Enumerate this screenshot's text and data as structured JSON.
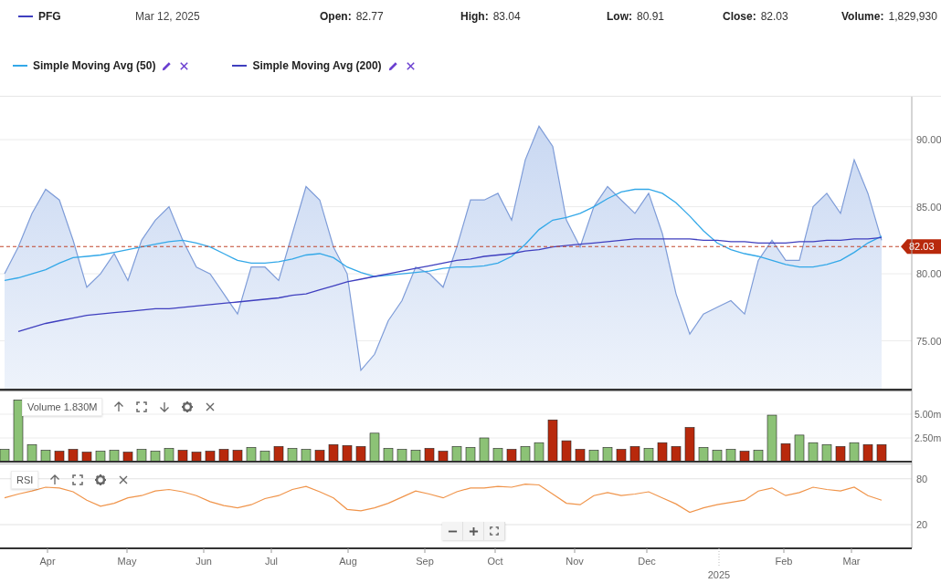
{
  "header": {
    "date": "Mar 12, 2025",
    "stats": [
      {
        "label": "Open:",
        "value": "82.77"
      },
      {
        "label": "High:",
        "value": "83.04"
      },
      {
        "label": "Low:",
        "value": "80.91"
      },
      {
        "label": "Close:",
        "value": "82.03"
      },
      {
        "label": "Volume:",
        "value": "1,829,930"
      }
    ]
  },
  "price_chart": {
    "chart_data": {
      "type": "area",
      "grid": true,
      "ref_lines": [
        {
          "axis": "y",
          "value": 82.03,
          "label": "82.03",
          "color": "#c0442a"
        }
      ],
      "ylim": [
        71.3,
        93.2
      ],
      "yticks": [
        {
          "value": 75,
          "label": "75.00"
        },
        {
          "value": 80,
          "label": "80.00"
        },
        {
          "value": 85,
          "label": "85.00"
        },
        {
          "value": 90,
          "label": "90.00"
        }
      ],
      "series": [
        {
          "name": "PFG",
          "color": "#7e9cd8",
          "values": [
            80.0,
            82,
            84.5,
            86.3,
            85.5,
            82.5,
            79,
            80,
            81.5,
            79.5,
            82.5,
            84,
            85,
            82.5,
            80.5,
            80,
            78.5,
            77,
            80.5,
            80.5,
            79.5,
            83,
            86.5,
            85.5,
            82,
            80,
            72.8,
            74,
            76.5,
            78,
            80.5,
            80,
            79,
            82,
            85.5,
            85.5,
            86,
            84,
            88.5,
            91,
            89.5,
            84,
            82,
            85,
            86.5,
            85.5,
            84.5,
            86,
            83,
            78.5,
            75.5,
            77,
            77.5,
            78,
            77,
            81,
            82.5,
            81,
            81,
            85,
            86,
            84.5,
            88.5,
            86,
            82.5
          ]
        },
        {
          "name": "Simple Moving Avg (50)",
          "type": "line",
          "color": "#33a8e8",
          "values": [
            79.5,
            79.7,
            80,
            80.3,
            80.8,
            81.2,
            81.3,
            81.4,
            81.6,
            81.8,
            82,
            82.2,
            82.4,
            82.5,
            82.3,
            82,
            81.5,
            81,
            80.8,
            80.8,
            80.9,
            81.1,
            81.4,
            81.5,
            81.2,
            80.5,
            80.1,
            79.8,
            79.9,
            80,
            80.1,
            80.2,
            80.4,
            80.5,
            80.5,
            80.6,
            80.8,
            81.3,
            82.2,
            83.3,
            84,
            84.2,
            84.5,
            85,
            85.6,
            86.1,
            86.3,
            86.3,
            86,
            85.3,
            84.3,
            83.2,
            82.3,
            81.8,
            81.5,
            81.3,
            81,
            80.7,
            80.5,
            80.5,
            80.7,
            81,
            81.6,
            82.3,
            82.8
          ]
        },
        {
          "name": "Simple Moving Avg (200)",
          "type": "line",
          "color": "#3f3fbf",
          "values": [
            null,
            75.7,
            76,
            76.3,
            76.5,
            76.7,
            76.9,
            77,
            77.1,
            77.2,
            77.3,
            77.4,
            77.4,
            77.5,
            77.6,
            77.7,
            77.8,
            77.9,
            78,
            78.1,
            78.2,
            78.4,
            78.5,
            78.8,
            79.1,
            79.4,
            79.6,
            79.8,
            80,
            80.2,
            80.4,
            80.6,
            80.8,
            81,
            81.1,
            81.3,
            81.4,
            81.5,
            81.7,
            81.8,
            82,
            82.1,
            82.2,
            82.3,
            82.4,
            82.5,
            82.6,
            82.6,
            82.6,
            82.6,
            82.6,
            82.5,
            82.5,
            82.4,
            82.4,
            82.3,
            82.3,
            82.3,
            82.4,
            82.4,
            82.5,
            82.5,
            82.6,
            82.6,
            82.7
          ]
        }
      ]
    }
  },
  "volume_panel": {
    "current_value": "1.830M",
    "chart_data": {
      "type": "bar",
      "grid": true,
      "ylim": [
        0,
        7.5
      ],
      "yticks": [
        {
          "value": 5,
          "label": "5.00m"
        },
        {
          "value": 2.5,
          "label": "2.50m"
        }
      ],
      "series": [
        {
          "name": "Volume",
          "color": "#8cc276",
          "values": [
            1.3,
            6.5,
            1.8,
            1.2,
            null,
            null,
            null,
            1.1,
            1.2,
            null,
            1.3,
            1.1,
            1.4,
            null,
            null,
            null,
            null,
            null,
            1.5,
            1.1,
            null,
            1.4,
            1.3,
            null,
            null,
            null,
            null,
            3.0,
            1.4,
            1.3,
            1.2,
            null,
            null,
            1.6,
            1.5,
            2.5,
            1.4,
            null,
            1.6,
            2.0,
            null,
            null,
            null,
            1.2,
            1.5,
            null,
            null,
            1.4,
            null,
            null,
            null,
            1.5,
            1.2,
            1.3,
            null,
            1.2,
            4.9,
            null,
            2.8,
            2.0,
            1.8,
            null,
            2.0,
            null,
            null
          ]
        },
        {
          "color": "#b8290c",
          "values": [
            null,
            null,
            null,
            null,
            1.1,
            1.3,
            1.0,
            null,
            null,
            1.0,
            null,
            null,
            null,
            1.2,
            1.0,
            1.1,
            1.3,
            1.2,
            null,
            null,
            1.6,
            null,
            null,
            1.2,
            1.8,
            1.7,
            1.6,
            null,
            null,
            null,
            null,
            1.4,
            1.1,
            null,
            null,
            null,
            null,
            1.3,
            null,
            null,
            4.4,
            2.2,
            1.3,
            null,
            null,
            1.3,
            1.6,
            null,
            2.0,
            1.6,
            3.6,
            null,
            null,
            null,
            1.1,
            null,
            null,
            1.9,
            null,
            null,
            null,
            1.6,
            null,
            1.8,
            1.8
          ]
        }
      ]
    }
  },
  "rsi_panel": {
    "chart_data": {
      "type": "line",
      "grid": true,
      "ylim": [
        -11,
        100
      ],
      "yticks": [
        20,
        80
      ],
      "series": [
        {
          "name": "RSI",
          "color": "#f0944a",
          "values": [
            55,
            60,
            64,
            69,
            68,
            63,
            52,
            44,
            48,
            55,
            58,
            64,
            66,
            63,
            58,
            50,
            45,
            42,
            46,
            54,
            58,
            66,
            70,
            63,
            55,
            40,
            38,
            42,
            48,
            56,
            64,
            60,
            55,
            63,
            68,
            68,
            70,
            69,
            73,
            72,
            60,
            48,
            46,
            58,
            62,
            58,
            60,
            63,
            55,
            47,
            36,
            42,
            46,
            49,
            52,
            64,
            68,
            58,
            62,
            69,
            66,
            64,
            69,
            58,
            52
          ]
        }
      ]
    }
  },
  "x_axis": {
    "labels": [
      "Apr",
      "May",
      "Jun",
      "Jul",
      "Aug",
      "Sep",
      "Oct",
      "Nov",
      "Dec",
      "Feb",
      "Mar"
    ],
    "year_label": "2025"
  }
}
